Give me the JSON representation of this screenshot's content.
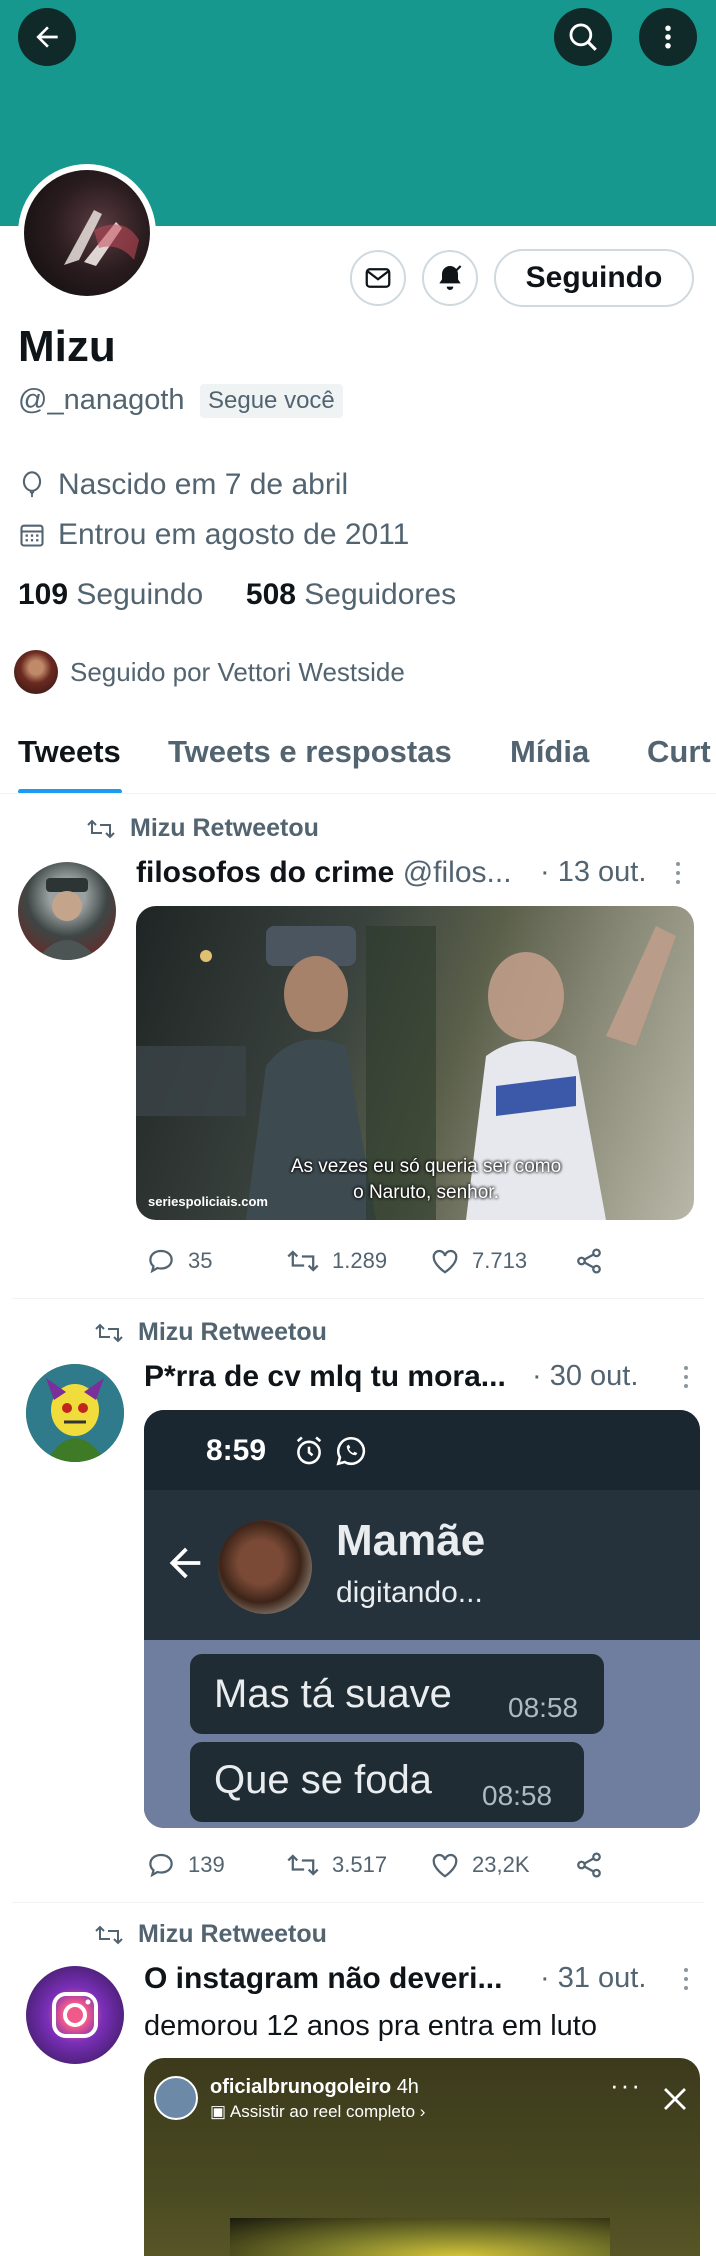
{
  "profile": {
    "name": "Mizu",
    "handle": "@_nanagoth",
    "follows_you": "Segue você",
    "birthday": "Nascido em 7 de abril",
    "joined": "Entrou em agosto de 2011",
    "following_count": "109",
    "following_label": "Seguindo",
    "followers_count": "508",
    "followers_label": "Seguidores",
    "followed_by": "Seguido por Vettori Westside",
    "follow_button": "Seguindo"
  },
  "colors": {
    "header": "#16988f",
    "accent": "#1d9bf0",
    "secondary_text": "#536471"
  },
  "tabs": [
    "Tweets",
    "Tweets e respostas",
    "Mídia",
    "Curt"
  ],
  "tweets": [
    {
      "retweet_label": "Mizu Retweetou",
      "author": "filosofos do crime",
      "handle": "@filos...",
      "date": "· 13 out.",
      "subtitle_line1": "As vezes eu só queria ser como",
      "subtitle_line2": "o Naruto, senhor.",
      "watermark": "seriespoliciais.com",
      "replies": "35",
      "retweets": "1.289",
      "likes": "7.713"
    },
    {
      "retweet_label": "Mizu Retweetou",
      "author": "P*rra de cv mlq tu mora...",
      "date": "· 30 out.",
      "chat": {
        "time": "8:59",
        "contact": "Mamãe",
        "status": "digitando...",
        "messages": [
          {
            "text": "Mas tá suave",
            "time": "08:58"
          },
          {
            "text": "Que se foda",
            "time": "08:58"
          }
        ]
      },
      "replies": "139",
      "retweets": "3.517",
      "likes": "23,2K"
    },
    {
      "retweet_label": "Mizu Retweetou",
      "author": "O instagram não deveri...",
      "date": "· 31 out.",
      "text": "demorou 12 anos pra entra em luto",
      "reel": {
        "account": "oficialbrunogoleiro",
        "age": "4h",
        "cta": "Assistir ao reel completo ›"
      }
    }
  ]
}
